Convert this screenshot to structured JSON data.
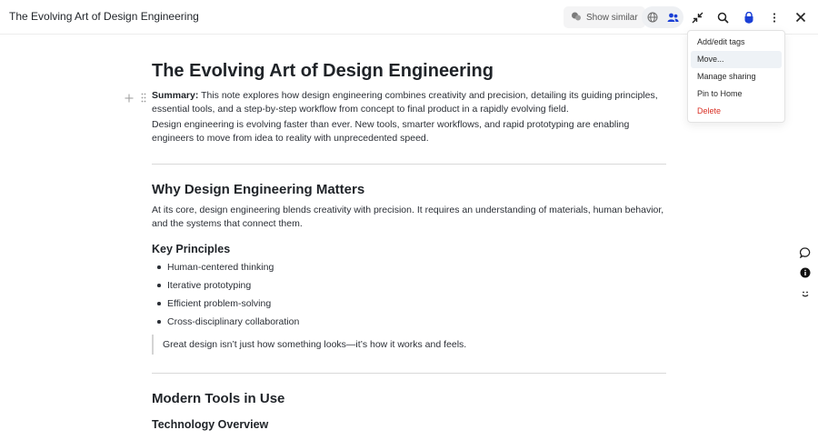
{
  "window": {
    "title": "The Evolving Art of Design Engineering"
  },
  "toolbar": {
    "show_similar_label": "Show similar",
    "icons": [
      "sparkle-icon",
      "globe-icon",
      "people-icon",
      "collapse-icon",
      "search-icon",
      "shield-icon",
      "more-icon",
      "close-icon"
    ]
  },
  "menu": {
    "items": [
      {
        "label": "Add/edit tags"
      },
      {
        "label": "Move..."
      },
      {
        "label": "Manage sharing"
      },
      {
        "label": "Pin to Home"
      },
      {
        "label": "Delete"
      }
    ],
    "colors": {
      "delete": "#d93025",
      "highlight": "#eef2f6"
    }
  },
  "doc": {
    "title": "The Evolving Art of Design Engineering",
    "summary_label": "Summary:",
    "summary_text": " This note explores how design engineering combines creativity and precision, detailing its guiding principles, essential tools, and a step-by-step workflow from concept to final product in a rapidly evolving field.",
    "intro": "Design engineering is evolving faster than ever. New tools, smarter workflows, and rapid prototyping are enabling engineers to move from idea to reality with unprecedented speed.",
    "section1": {
      "heading": "Why Design Engineering Matters",
      "body": "At its core, design engineering blends creativity with precision. It requires an understanding of materials, human behavior, and the systems that connect them."
    },
    "principles": {
      "heading": "Key Principles",
      "items": [
        "Human-centered thinking",
        "Iterative prototyping",
        "Efficient problem-solving",
        "Cross-disciplinary collaboration"
      ]
    },
    "quote": "Great design isn’t just how something looks—it’s how it works and feels.",
    "section2": {
      "heading": "Modern Tools in Use"
    },
    "subsection": {
      "heading": "Technology Overview"
    }
  },
  "side_rail": {
    "icons": [
      "comment-icon",
      "info-icon",
      "emoji-icon"
    ]
  },
  "colors": {
    "accent_blue": "#1a3fd6",
    "text": "#1f2328"
  }
}
